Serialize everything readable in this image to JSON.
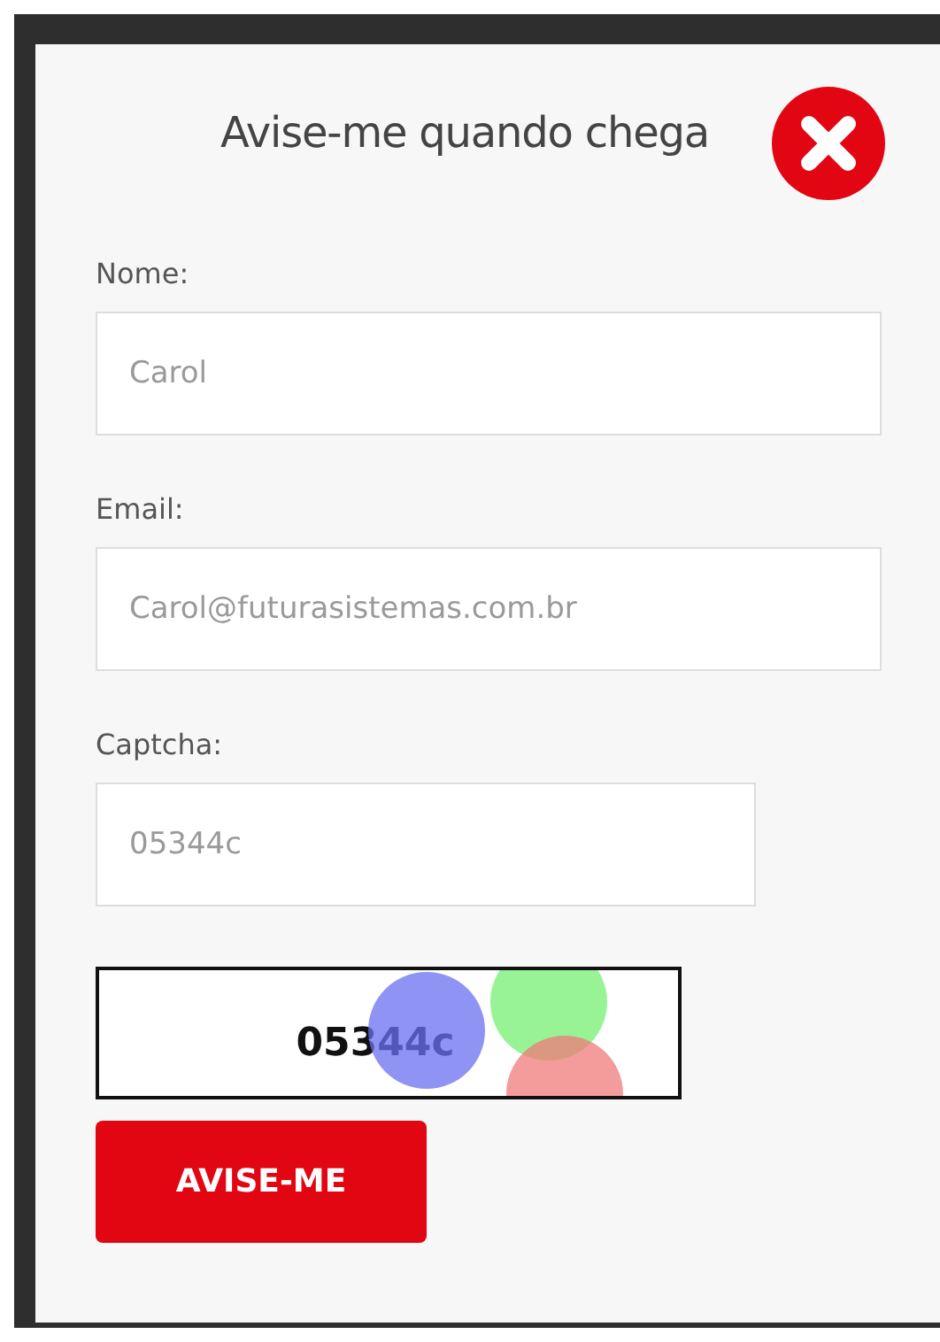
{
  "modal": {
    "title": "Avise-me quando chega",
    "fields": [
      {
        "label": "Nome:",
        "value": "Carol",
        "kind": "wide"
      },
      {
        "label": "Email:",
        "value": "Carol@futurasistemas.com.br",
        "kind": "wide"
      },
      {
        "label": "Captcha:",
        "value": "05344c",
        "kind": "narrow"
      }
    ],
    "captcha_image": {
      "text": "05344c"
    },
    "submit_button": "AVISE-ME"
  }
}
